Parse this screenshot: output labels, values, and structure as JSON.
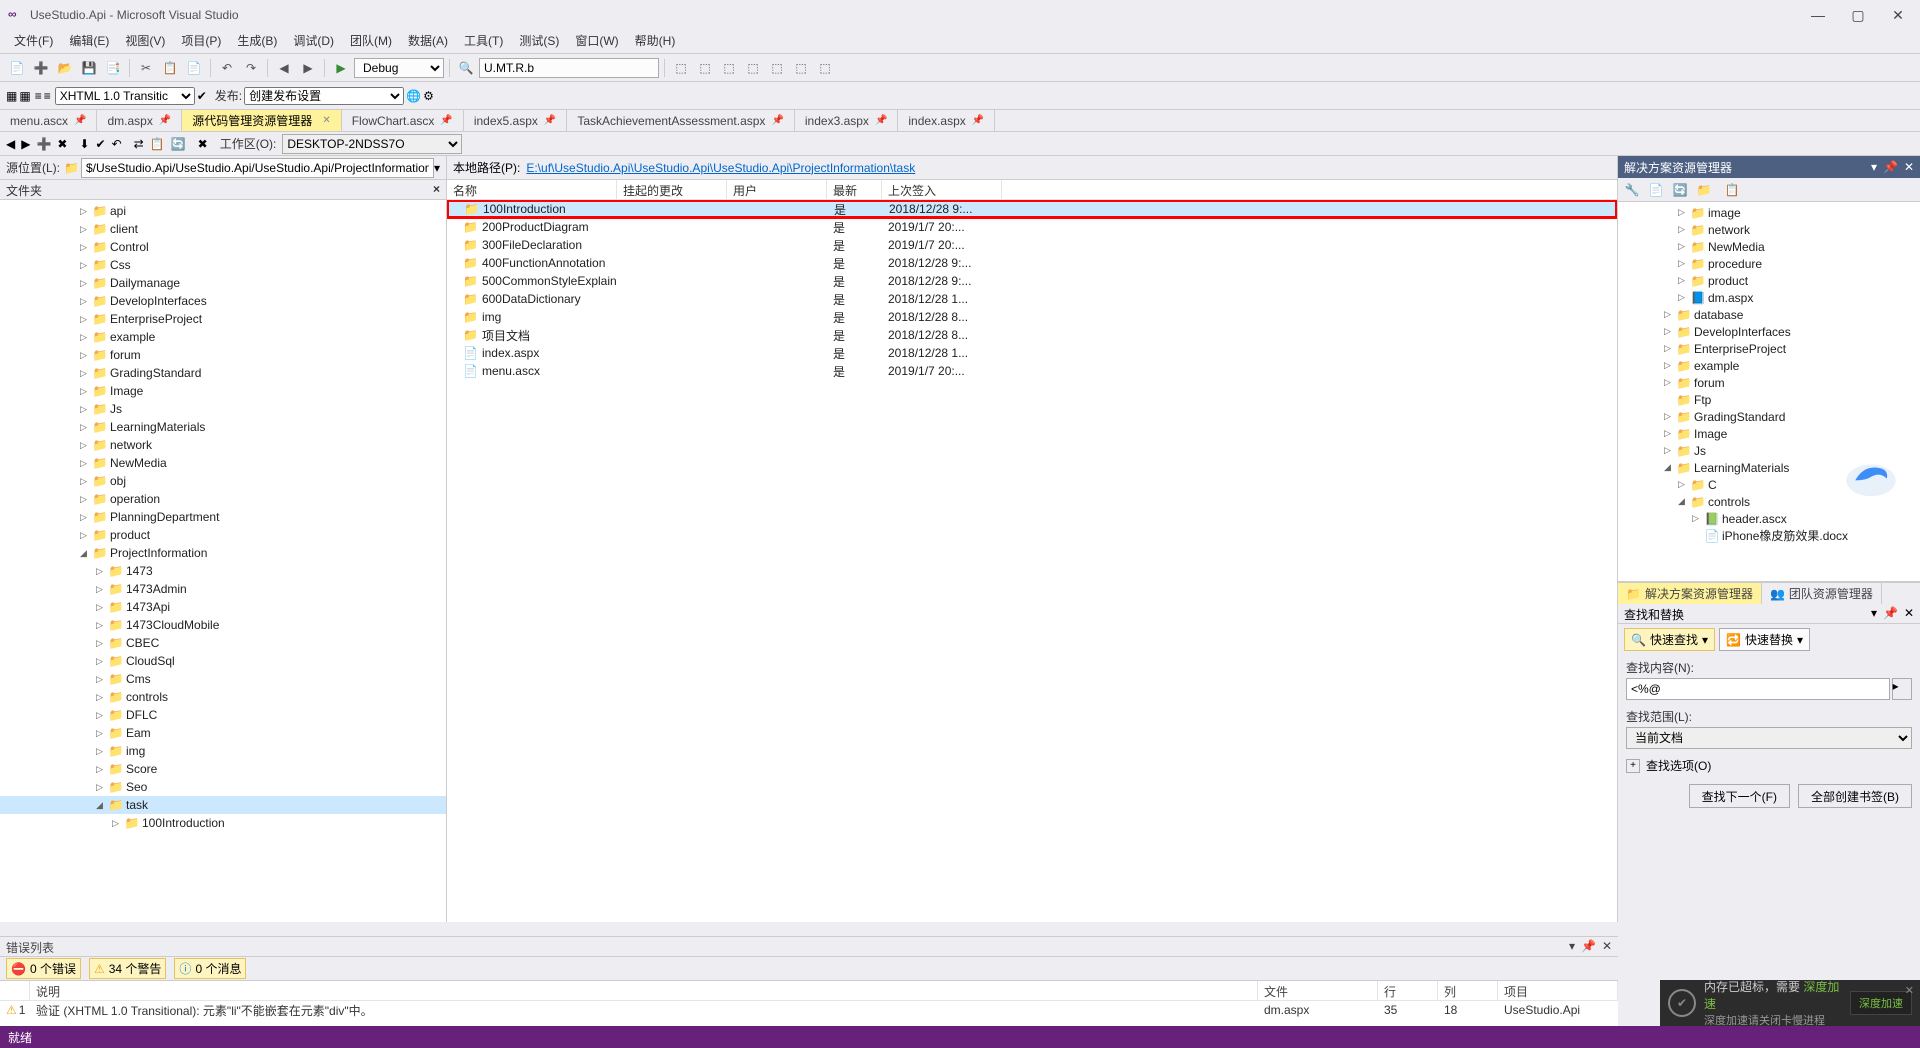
{
  "title": "UseStudio.Api - Microsoft Visual Studio",
  "window_buttons": {
    "min": "—",
    "max": "▢",
    "close": "✕"
  },
  "menu": [
    "文件(F)",
    "编辑(E)",
    "视图(V)",
    "项目(P)",
    "生成(B)",
    "调试(D)",
    "团队(M)",
    "数据(A)",
    "工具(T)",
    "测试(S)",
    "窗口(W)",
    "帮助(H)"
  ],
  "toolbar1": {
    "config": "Debug",
    "target": "U.MT.R.b"
  },
  "toolbar2": {
    "doctype": "XHTML 1.0 Transitic",
    "publish_label": "发布:",
    "publish_value": "创建发布设置"
  },
  "tabs": [
    {
      "label": "menu.ascx",
      "pinned": true
    },
    {
      "label": "dm.aspx",
      "pinned": true
    },
    {
      "label": "源代码管理资源管理器",
      "active": true,
      "close": true
    },
    {
      "label": "FlowChart.ascx",
      "pinned": true
    },
    {
      "label": "index5.aspx",
      "pinned": true
    },
    {
      "label": "TaskAchievementAssessment.aspx",
      "pinned": true
    },
    {
      "label": "index3.aspx",
      "pinned": true
    },
    {
      "label": "index.aspx",
      "pinned": true
    }
  ],
  "src_toolbar": {
    "workspace_label": "工作区(O):",
    "workspace_value": "DESKTOP-2NDSS7O"
  },
  "left": {
    "src_location_label": "源位置(L):",
    "src_location_value": "$/UseStudio.Api/UseStudio.Api/UseStudio.Api/ProjectInformation/task",
    "header": "文件夹",
    "tree": [
      {
        "l": "api",
        "d": 5
      },
      {
        "l": "client",
        "d": 5
      },
      {
        "l": "Control",
        "d": 5
      },
      {
        "l": "Css",
        "d": 5
      },
      {
        "l": "Dailymanage",
        "d": 5
      },
      {
        "l": "DevelopInterfaces",
        "d": 5
      },
      {
        "l": "EnterpriseProject",
        "d": 5
      },
      {
        "l": "example",
        "d": 5
      },
      {
        "l": "forum",
        "d": 5
      },
      {
        "l": "GradingStandard",
        "d": 5
      },
      {
        "l": "Image",
        "d": 5
      },
      {
        "l": "Js",
        "d": 5
      },
      {
        "l": "LearningMaterials",
        "d": 5
      },
      {
        "l": "network",
        "d": 5
      },
      {
        "l": "NewMedia",
        "d": 5
      },
      {
        "l": "obj",
        "d": 5
      },
      {
        "l": "operation",
        "d": 5
      },
      {
        "l": "PlanningDepartment",
        "d": 5
      },
      {
        "l": "product",
        "d": 5
      },
      {
        "l": "ProjectInformation",
        "d": 5,
        "exp": true
      },
      {
        "l": "1473",
        "d": 6
      },
      {
        "l": "1473Admin",
        "d": 6
      },
      {
        "l": "1473Api",
        "d": 6
      },
      {
        "l": "1473CloudMobile",
        "d": 6
      },
      {
        "l": "CBEC",
        "d": 6
      },
      {
        "l": "CloudSql",
        "d": 6
      },
      {
        "l": "Cms",
        "d": 6
      },
      {
        "l": "controls",
        "d": 6
      },
      {
        "l": "DFLC",
        "d": 6
      },
      {
        "l": "Eam",
        "d": 6
      },
      {
        "l": "img",
        "d": 6
      },
      {
        "l": "Score",
        "d": 6
      },
      {
        "l": "Seo",
        "d": 6
      },
      {
        "l": "task",
        "d": 6,
        "sel": true,
        "exp": true
      },
      {
        "l": "100Introduction",
        "d": 7
      }
    ]
  },
  "center": {
    "path_label": "本地路径(P):",
    "path_link": "E:\\uf\\UseStudio.Api\\UseStudio.Api\\UseStudio.Api\\ProjectInformation\\task",
    "columns": {
      "name": "名称",
      "pending": "挂起的更改",
      "user": "用户",
      "latest": "最新",
      "checkin": "上次签入"
    },
    "col_widths": {
      "name": 170,
      "pending": 110,
      "user": 100,
      "latest": 55,
      "checkin": 120
    },
    "rows": [
      {
        "icon": "folder",
        "name": "100Introduction",
        "latest": "是",
        "checkin": "2018/12/28 9:...",
        "hl": true,
        "sel": true
      },
      {
        "icon": "folder",
        "name": "200ProductDiagram",
        "latest": "是",
        "checkin": "2019/1/7 20:..."
      },
      {
        "icon": "folder",
        "name": "300FileDeclaration",
        "latest": "是",
        "checkin": "2019/1/7 20:..."
      },
      {
        "icon": "folder",
        "name": "400FunctionAnnotation",
        "latest": "是",
        "checkin": "2018/12/28 9:..."
      },
      {
        "icon": "folder",
        "name": "500CommonStyleExplain",
        "latest": "是",
        "checkin": "2018/12/28 9:..."
      },
      {
        "icon": "folder",
        "name": "600DataDictionary",
        "latest": "是",
        "checkin": "2018/12/28 1..."
      },
      {
        "icon": "folder",
        "name": "img",
        "latest": "是",
        "checkin": "2018/12/28 8..."
      },
      {
        "icon": "folder",
        "name": "项目文档",
        "latest": "是",
        "checkin": "2018/12/28 8..."
      },
      {
        "icon": "file",
        "name": "index.aspx",
        "latest": "是",
        "checkin": "2018/12/28 1..."
      },
      {
        "icon": "file",
        "name": "menu.ascx",
        "latest": "是",
        "checkin": "2019/1/7 20:..."
      }
    ]
  },
  "right": {
    "solution_title": "解决方案资源管理器",
    "tree": [
      {
        "l": "image",
        "d": 4,
        "a": "▷",
        "i": "folder"
      },
      {
        "l": "network",
        "d": 4,
        "a": "▷",
        "i": "folder"
      },
      {
        "l": "NewMedia",
        "d": 4,
        "a": "▷",
        "i": "folder"
      },
      {
        "l": "procedure",
        "d": 4,
        "a": "▷",
        "i": "folder"
      },
      {
        "l": "product",
        "d": 4,
        "a": "▷",
        "i": "folder"
      },
      {
        "l": "dm.aspx",
        "d": 4,
        "a": "▷",
        "i": "aspx"
      },
      {
        "l": "database",
        "d": 3,
        "a": "▷",
        "i": "folder"
      },
      {
        "l": "DevelopInterfaces",
        "d": 3,
        "a": "▷",
        "i": "folder"
      },
      {
        "l": "EnterpriseProject",
        "d": 3,
        "a": "▷",
        "i": "folder"
      },
      {
        "l": "example",
        "d": 3,
        "a": "▷",
        "i": "folder"
      },
      {
        "l": "forum",
        "d": 3,
        "a": "▷",
        "i": "folder"
      },
      {
        "l": "Ftp",
        "d": 3,
        "a": "",
        "i": "folder"
      },
      {
        "l": "GradingStandard",
        "d": 3,
        "a": "▷",
        "i": "folder"
      },
      {
        "l": "Image",
        "d": 3,
        "a": "▷",
        "i": "folder"
      },
      {
        "l": "Js",
        "d": 3,
        "a": "▷",
        "i": "folder"
      },
      {
        "l": "LearningMaterials",
        "d": 3,
        "a": "◢",
        "i": "folder"
      },
      {
        "l": "C",
        "d": 4,
        "a": "▷",
        "i": "folder"
      },
      {
        "l": "controls",
        "d": 4,
        "a": "◢",
        "i": "folder"
      },
      {
        "l": "header.ascx",
        "d": 5,
        "a": "▷",
        "i": "ascx"
      },
      {
        "l": "iPhone橡皮筋效果.docx",
        "d": 5,
        "a": "",
        "i": "docx"
      }
    ],
    "tabs2": [
      {
        "label": "解决方案资源管理器",
        "active": true,
        "icon": "📁"
      },
      {
        "label": "团队资源管理器",
        "icon": "👥"
      }
    ],
    "find": {
      "title": "查找和替换",
      "quick_find": "快速查找",
      "quick_replace": "快速替换",
      "content_label": "查找内容(N):",
      "content_value": "<%@",
      "scope_label": "查找范围(L):",
      "scope_value": "当前文档",
      "options_label": "查找选项(O)",
      "btn_next": "查找下一个(F)",
      "btn_bookmark": "全部创建书签(B)"
    }
  },
  "errors": {
    "title": "错误列表",
    "filters": {
      "err": "0 个错误",
      "warn": "34 个警告",
      "msg": "0 个消息"
    },
    "cols": {
      "desc": "说明",
      "file": "文件",
      "line": "行",
      "col": "列",
      "proj": "项目"
    },
    "row": {
      "num": "1",
      "desc": "验证 (XHTML 1.0 Transitional): 元素\"li\"不能嵌套在元素\"div\"中。",
      "file": "dm.aspx",
      "line": "35",
      "col": "18",
      "proj": "UseStudio.Api"
    }
  },
  "statusbar": "就绪",
  "speedup": {
    "line1a": "内存已超标，需要 ",
    "line1b": "深度加速",
    "line2": "深度加速请关闭卡慢进程",
    "btn": "深度加速"
  }
}
